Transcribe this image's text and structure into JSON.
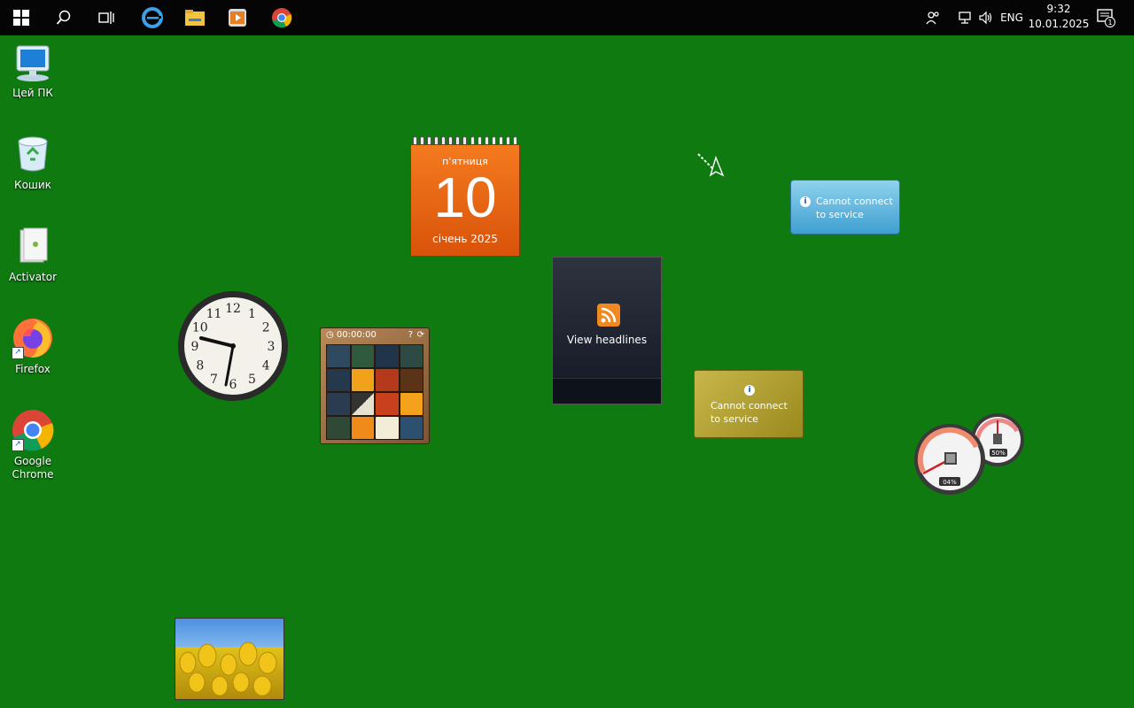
{
  "taskbar": {
    "pinned": [
      "start-icon",
      "search-icon",
      "task-view-icon",
      "edge-icon",
      "file-explorer-icon",
      "media-player-icon",
      "chrome-icon"
    ],
    "tray": {
      "language": "ENG",
      "time": "9:32",
      "date": "10.01.2025",
      "notification_count": "1"
    }
  },
  "desktop_icons": [
    {
      "label": "Цей ПК"
    },
    {
      "label": "Кошик"
    },
    {
      "label": "Activator"
    },
    {
      "label": "Firefox"
    },
    {
      "label": "Google Chrome"
    }
  ],
  "gadgets": {
    "calendar": {
      "weekday": "п'ятниця",
      "day": "10",
      "month_year": "січень 2025"
    },
    "clock": {
      "numerals": [
        "12",
        "1",
        "2",
        "3",
        "4",
        "5",
        "6",
        "7",
        "8",
        "9",
        "10",
        "11"
      ]
    },
    "puzzle": {
      "timer": "00:00:00"
    },
    "feed": {
      "label": "View headlines"
    },
    "weather": {
      "message": "Cannot connect to service"
    },
    "currency": {
      "message": "Cannot connect to service"
    },
    "meter": {
      "cpu": "04%",
      "memory": "50%"
    }
  }
}
